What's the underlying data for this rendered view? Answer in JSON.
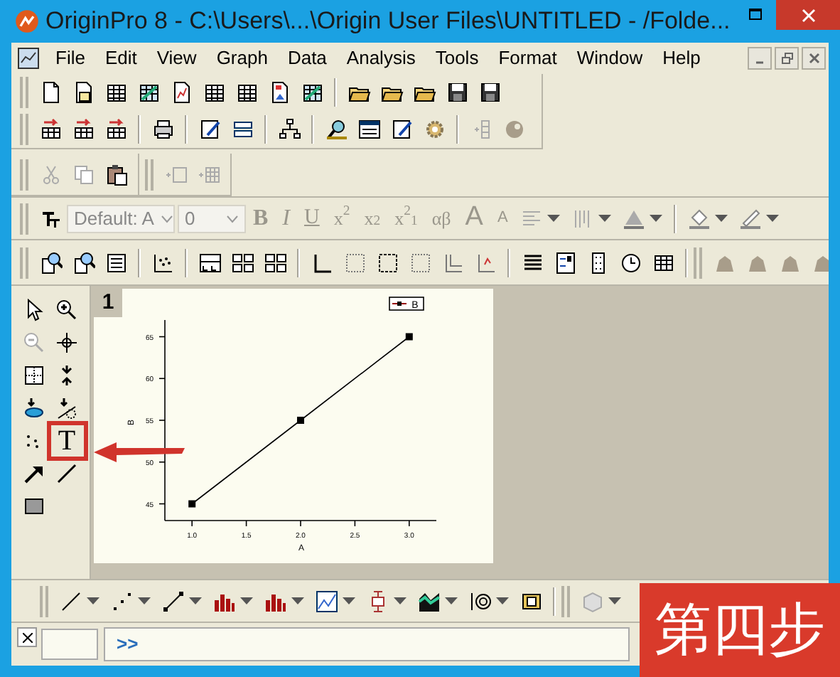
{
  "window": {
    "title": "OriginPro 8 - C:\\Users\\...\\Origin User Files\\UNTITLED - /Folde..."
  },
  "menu": [
    {
      "label": "File"
    },
    {
      "label": "Edit"
    },
    {
      "label": "View"
    },
    {
      "label": "Graph"
    },
    {
      "label": "Data"
    },
    {
      "label": "Analysis"
    },
    {
      "label": "Tools"
    },
    {
      "label": "Format"
    },
    {
      "label": "Window"
    },
    {
      "label": "Help"
    }
  ],
  "format_toolbar": {
    "font": "Default: A",
    "size": "0",
    "buttons": [
      {
        "label": "B",
        "kind": "bold",
        "disabled": true
      },
      {
        "label": "I",
        "kind": "italic",
        "disabled": true
      },
      {
        "label": "U",
        "kind": "underline",
        "disabled": true
      },
      {
        "label": "x$^{2}$",
        "kind": "plain",
        "disabled": true
      },
      {
        "label": "x$_{2}$",
        "kind": "plain",
        "disabled": true
      },
      {
        "label": "x$^{2}$$_{1}$",
        "kind": "plain",
        "disabled": true
      },
      {
        "label": "αβ",
        "kind": "plain",
        "disabled": true
      },
      {
        "label": "A",
        "kind": "large",
        "disabled": true
      },
      {
        "label": "A",
        "kind": "small",
        "disabled": true
      }
    ]
  },
  "tools_panel": {
    "text_tool": "T"
  },
  "graph_window": {
    "number": "1",
    "chart_data": {
      "type": "line",
      "xlabel": "A",
      "ylabel": "B",
      "x": [
        1,
        2,
        3
      ],
      "series": [
        {
          "name": "B",
          "color": "#000000",
          "marker": "square",
          "values": [
            45,
            55,
            65
          ]
        }
      ],
      "xlim": [
        0.75,
        3.25
      ],
      "ylim": [
        43,
        67
      ],
      "xticks": [
        {
          "value": 1,
          "label": "1.0"
        },
        {
          "value": 1.5,
          "label": "1.5"
        },
        {
          "value": 2,
          "label": "2.0"
        },
        {
          "value": 2.5,
          "label": "2.5"
        },
        {
          "value": 3,
          "label": "3.0"
        }
      ],
      "yticks": [
        45,
        50,
        55,
        60,
        65
      ]
    }
  },
  "command_window": {
    "prompt": ">>"
  },
  "step_label": "第四步"
}
